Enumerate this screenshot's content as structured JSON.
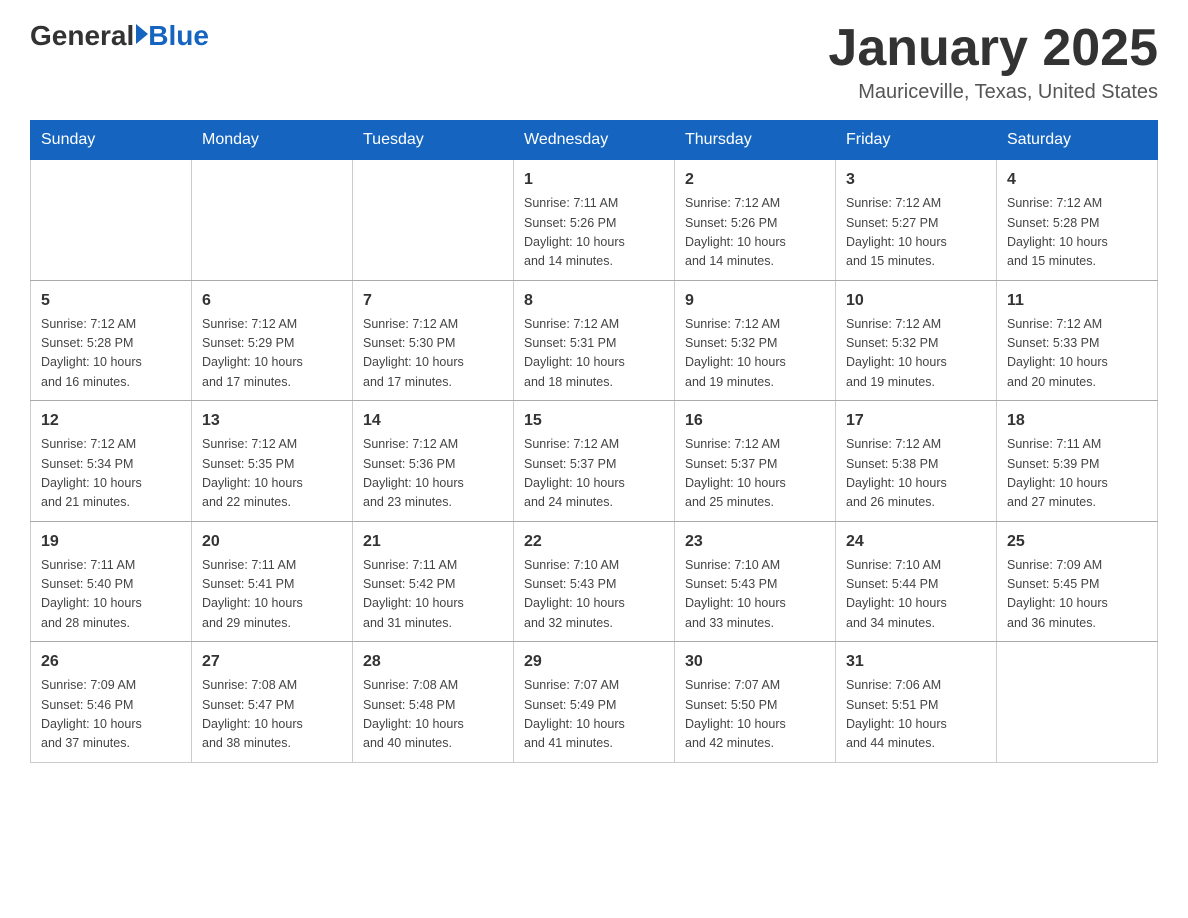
{
  "logo": {
    "general": "General",
    "blue": "Blue"
  },
  "title": "January 2025",
  "subtitle": "Mauriceville, Texas, United States",
  "weekdays": [
    "Sunday",
    "Monday",
    "Tuesday",
    "Wednesday",
    "Thursday",
    "Friday",
    "Saturday"
  ],
  "weeks": [
    [
      {
        "day": "",
        "info": ""
      },
      {
        "day": "",
        "info": ""
      },
      {
        "day": "",
        "info": ""
      },
      {
        "day": "1",
        "info": "Sunrise: 7:11 AM\nSunset: 5:26 PM\nDaylight: 10 hours\nand 14 minutes."
      },
      {
        "day": "2",
        "info": "Sunrise: 7:12 AM\nSunset: 5:26 PM\nDaylight: 10 hours\nand 14 minutes."
      },
      {
        "day": "3",
        "info": "Sunrise: 7:12 AM\nSunset: 5:27 PM\nDaylight: 10 hours\nand 15 minutes."
      },
      {
        "day": "4",
        "info": "Sunrise: 7:12 AM\nSunset: 5:28 PM\nDaylight: 10 hours\nand 15 minutes."
      }
    ],
    [
      {
        "day": "5",
        "info": "Sunrise: 7:12 AM\nSunset: 5:28 PM\nDaylight: 10 hours\nand 16 minutes."
      },
      {
        "day": "6",
        "info": "Sunrise: 7:12 AM\nSunset: 5:29 PM\nDaylight: 10 hours\nand 17 minutes."
      },
      {
        "day": "7",
        "info": "Sunrise: 7:12 AM\nSunset: 5:30 PM\nDaylight: 10 hours\nand 17 minutes."
      },
      {
        "day": "8",
        "info": "Sunrise: 7:12 AM\nSunset: 5:31 PM\nDaylight: 10 hours\nand 18 minutes."
      },
      {
        "day": "9",
        "info": "Sunrise: 7:12 AM\nSunset: 5:32 PM\nDaylight: 10 hours\nand 19 minutes."
      },
      {
        "day": "10",
        "info": "Sunrise: 7:12 AM\nSunset: 5:32 PM\nDaylight: 10 hours\nand 19 minutes."
      },
      {
        "day": "11",
        "info": "Sunrise: 7:12 AM\nSunset: 5:33 PM\nDaylight: 10 hours\nand 20 minutes."
      }
    ],
    [
      {
        "day": "12",
        "info": "Sunrise: 7:12 AM\nSunset: 5:34 PM\nDaylight: 10 hours\nand 21 minutes."
      },
      {
        "day": "13",
        "info": "Sunrise: 7:12 AM\nSunset: 5:35 PM\nDaylight: 10 hours\nand 22 minutes."
      },
      {
        "day": "14",
        "info": "Sunrise: 7:12 AM\nSunset: 5:36 PM\nDaylight: 10 hours\nand 23 minutes."
      },
      {
        "day": "15",
        "info": "Sunrise: 7:12 AM\nSunset: 5:37 PM\nDaylight: 10 hours\nand 24 minutes."
      },
      {
        "day": "16",
        "info": "Sunrise: 7:12 AM\nSunset: 5:37 PM\nDaylight: 10 hours\nand 25 minutes."
      },
      {
        "day": "17",
        "info": "Sunrise: 7:12 AM\nSunset: 5:38 PM\nDaylight: 10 hours\nand 26 minutes."
      },
      {
        "day": "18",
        "info": "Sunrise: 7:11 AM\nSunset: 5:39 PM\nDaylight: 10 hours\nand 27 minutes."
      }
    ],
    [
      {
        "day": "19",
        "info": "Sunrise: 7:11 AM\nSunset: 5:40 PM\nDaylight: 10 hours\nand 28 minutes."
      },
      {
        "day": "20",
        "info": "Sunrise: 7:11 AM\nSunset: 5:41 PM\nDaylight: 10 hours\nand 29 minutes."
      },
      {
        "day": "21",
        "info": "Sunrise: 7:11 AM\nSunset: 5:42 PM\nDaylight: 10 hours\nand 31 minutes."
      },
      {
        "day": "22",
        "info": "Sunrise: 7:10 AM\nSunset: 5:43 PM\nDaylight: 10 hours\nand 32 minutes."
      },
      {
        "day": "23",
        "info": "Sunrise: 7:10 AM\nSunset: 5:43 PM\nDaylight: 10 hours\nand 33 minutes."
      },
      {
        "day": "24",
        "info": "Sunrise: 7:10 AM\nSunset: 5:44 PM\nDaylight: 10 hours\nand 34 minutes."
      },
      {
        "day": "25",
        "info": "Sunrise: 7:09 AM\nSunset: 5:45 PM\nDaylight: 10 hours\nand 36 minutes."
      }
    ],
    [
      {
        "day": "26",
        "info": "Sunrise: 7:09 AM\nSunset: 5:46 PM\nDaylight: 10 hours\nand 37 minutes."
      },
      {
        "day": "27",
        "info": "Sunrise: 7:08 AM\nSunset: 5:47 PM\nDaylight: 10 hours\nand 38 minutes."
      },
      {
        "day": "28",
        "info": "Sunrise: 7:08 AM\nSunset: 5:48 PM\nDaylight: 10 hours\nand 40 minutes."
      },
      {
        "day": "29",
        "info": "Sunrise: 7:07 AM\nSunset: 5:49 PM\nDaylight: 10 hours\nand 41 minutes."
      },
      {
        "day": "30",
        "info": "Sunrise: 7:07 AM\nSunset: 5:50 PM\nDaylight: 10 hours\nand 42 minutes."
      },
      {
        "day": "31",
        "info": "Sunrise: 7:06 AM\nSunset: 5:51 PM\nDaylight: 10 hours\nand 44 minutes."
      },
      {
        "day": "",
        "info": ""
      }
    ]
  ]
}
